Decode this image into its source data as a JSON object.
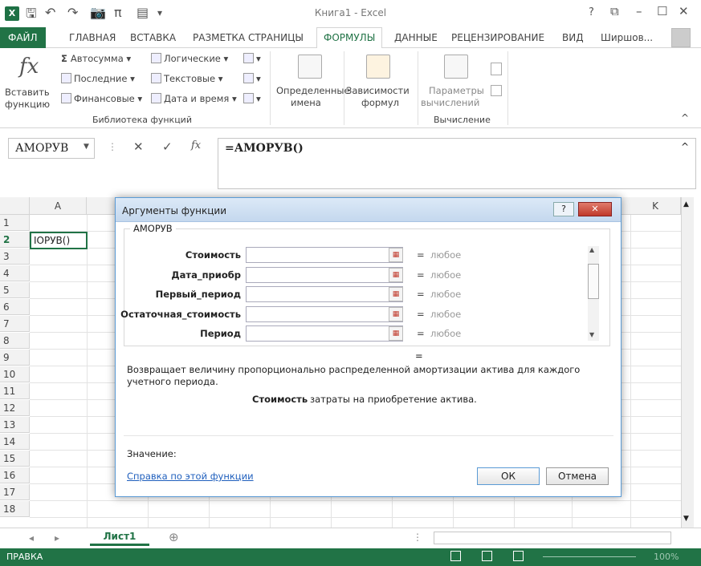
{
  "window": {
    "title": "Книга1 - Excel",
    "help": "?",
    "restore": "⧉",
    "minimize": "–",
    "maximize": "☐",
    "close": "✕"
  },
  "qat": {
    "save": "🖫",
    "undo": "↶",
    "redo": "↷",
    "camera": "📷",
    "pi": "π",
    "form": "▤",
    "more": "▾"
  },
  "ribbon_tabs": [
    {
      "label": "ФАЙЛ"
    },
    {
      "label": "ГЛАВНАЯ"
    },
    {
      "label": "ВСТАВКА"
    },
    {
      "label": "РАЗМЕТКА СТРАНИЦЫ"
    },
    {
      "label": "ФОРМУЛЫ"
    },
    {
      "label": "ДАННЫЕ"
    },
    {
      "label": "РЕЦЕНЗИРОВАНИЕ"
    },
    {
      "label": "ВИД"
    },
    {
      "label": "Ширшов..."
    }
  ],
  "ribbon": {
    "insert_fn_l1": "Вставить",
    "insert_fn_l2": "функцию",
    "fx_symbol": "fx",
    "autosum": "Автосумма",
    "recent": "Последние",
    "financial": "Финансовые",
    "logical": "Логические",
    "text": "Текстовые",
    "datetime": "Дата и время",
    "lib_group": "Библиотека функций",
    "defined_l1": "Определенные",
    "defined_l2": "имена",
    "audit_l1": "Зависимости",
    "audit_l2": "формул",
    "calc_l1": "Параметры",
    "calc_l2": "вычислений",
    "calc_group": "Вычисление",
    "collapse": "^"
  },
  "formula_bar": {
    "namebox": "АМОРУВ",
    "cancel": "✕",
    "enter": "✓",
    "fx": "fx",
    "formula": "=АМОРУВ()",
    "expand": "^"
  },
  "grid": {
    "cols": [
      "A",
      "K"
    ],
    "rows": [
      "1",
      "2",
      "3",
      "4",
      "5",
      "6",
      "7",
      "8",
      "9",
      "10",
      "11",
      "12",
      "13",
      "14",
      "15",
      "16",
      "17",
      "18"
    ],
    "cell_a2": "ІОРУВ()"
  },
  "dialog": {
    "title": "Аргументы функции",
    "help": "?",
    "close": "✕",
    "fn_name": "АМОРУВ",
    "args": [
      {
        "label": "Стоимость",
        "eq": "=",
        "value": "любое"
      },
      {
        "label": "Дата_приобр",
        "eq": "=",
        "value": "любое"
      },
      {
        "label": "Первый_период",
        "eq": "=",
        "value": "любое"
      },
      {
        "label": "Остаточная_стоимость",
        "eq": "=",
        "value": "любое"
      },
      {
        "label": "Период",
        "eq": "=",
        "value": "любое"
      }
    ],
    "result_eq": "=",
    "description": "Возвращает величину пропорционально распределенной амортизации актива для каждого учетного периода.",
    "arg_name": "Стоимость",
    "arg_desc": "затраты на приобретение актива.",
    "value_label": "Значение:",
    "help_link": "Справка по этой функции",
    "ok": "ОК",
    "cancel": "Отмена"
  },
  "sheets": {
    "prev": "◂",
    "next": "▸",
    "active": "Лист1",
    "add": "⊕"
  },
  "status": {
    "mode": "ПРАВКА",
    "zoom": "100%"
  }
}
